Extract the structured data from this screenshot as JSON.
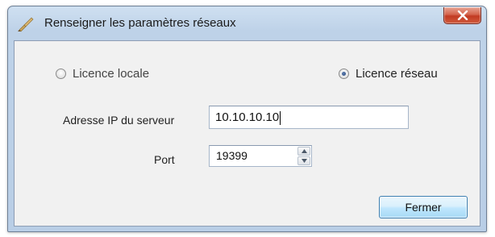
{
  "window": {
    "title": "Renseigner les paramètres réseaux",
    "close_icon": "close-x-icon",
    "app_icon": "brush-icon"
  },
  "license": {
    "local_label": "Licence locale",
    "network_label": "Licence réseau",
    "selected": "network"
  },
  "server": {
    "ip_label": "Adresse IP du serveur",
    "ip_value": "10.10.10.10",
    "port_label": "Port",
    "port_value": "19399"
  },
  "buttons": {
    "close_label": "Fermer"
  },
  "colors": {
    "title_bar": "#bed2e8",
    "client_bg": "#f1f1f1",
    "close_button": "#c23a22",
    "button_border": "#3c7fb1"
  }
}
